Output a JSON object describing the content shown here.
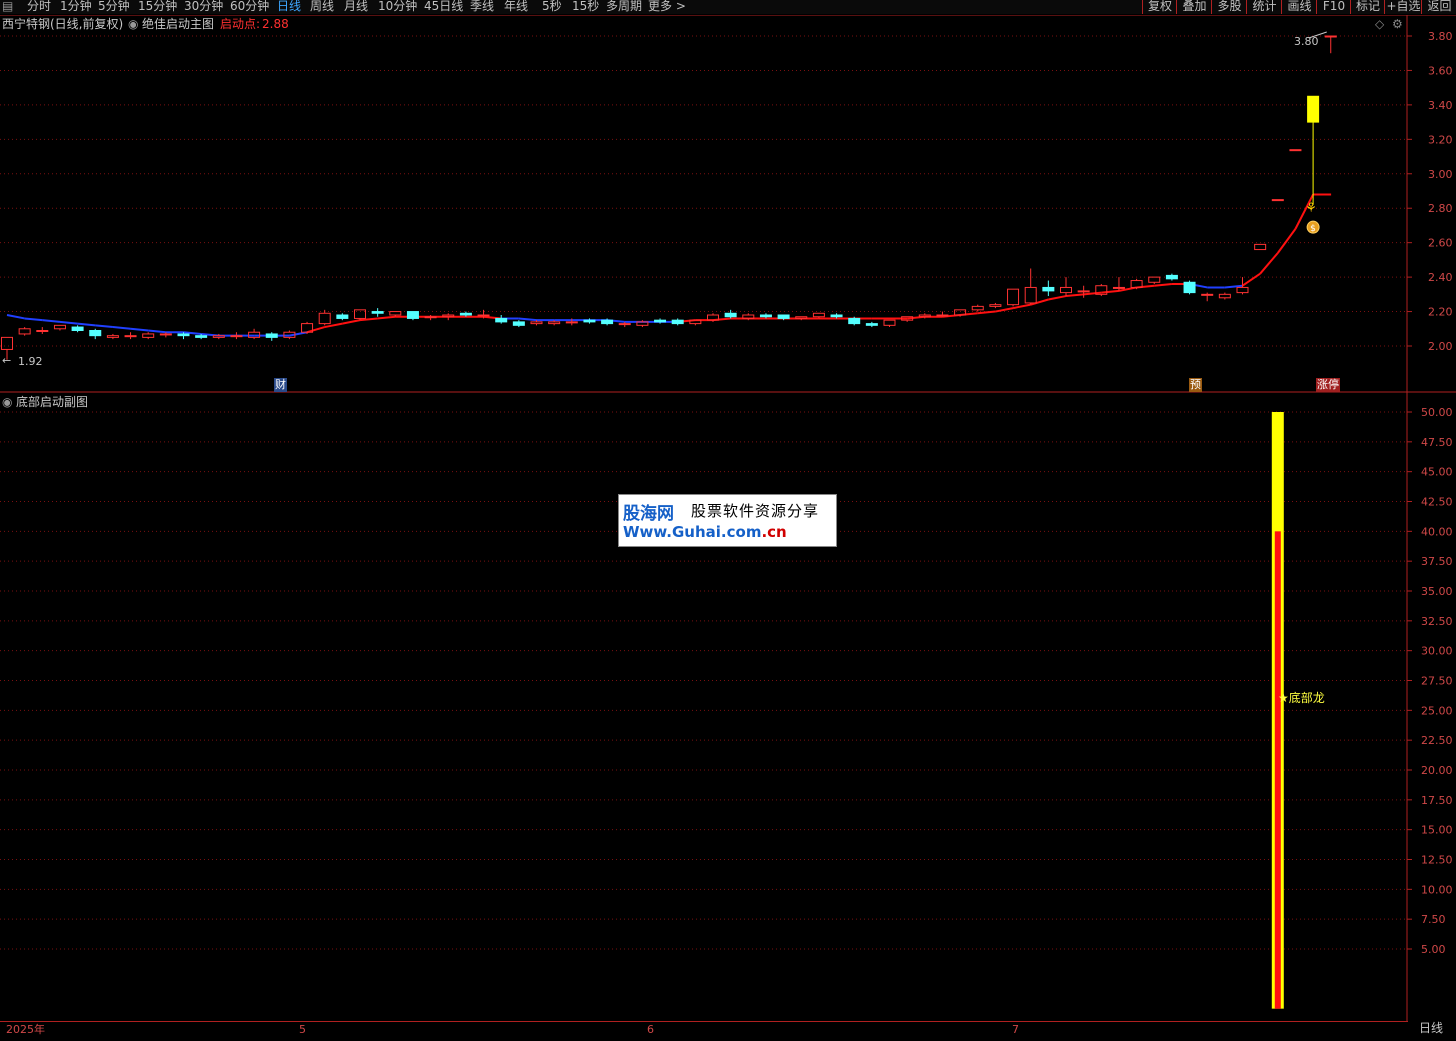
{
  "toolbar": {
    "periods": [
      "分时",
      "1分钟",
      "5分钟",
      "15分钟",
      "30分钟",
      "60分钟",
      "日线",
      "周线",
      "月线",
      "10分钟",
      "45日线",
      "季线",
      "年线",
      "5秒",
      "15秒",
      "多周期",
      "更多 >"
    ],
    "active_period": "日线",
    "right_buttons": [
      "复权",
      "叠加",
      "多股",
      "统计",
      "画线",
      "F10",
      "标记",
      "+自选",
      "返回"
    ]
  },
  "main_chart": {
    "stock_title": "西宁特钢(日线,前复权)",
    "indicator_name": "绝佳启动主图",
    "signal_label": "启动点:",
    "signal_value": "2.88",
    "high_marker": "3.80",
    "low_marker": "1.92",
    "event_badges": [
      "财",
      "预",
      "涨停"
    ],
    "y_ticks": [
      "3.80",
      "3.60",
      "3.40",
      "3.20",
      "3.00",
      "2.80",
      "2.60",
      "2.40",
      "2.20",
      "2.00"
    ]
  },
  "sub_chart": {
    "indicator_name": "底部启动副图",
    "signal_text": "★底部龙",
    "y_ticks": [
      "50.00",
      "47.50",
      "45.00",
      "42.50",
      "40.00",
      "37.50",
      "35.00",
      "32.50",
      "30.00",
      "27.50",
      "25.00",
      "22.50",
      "20.00",
      "17.50",
      "15.00",
      "12.50",
      "10.00",
      "7.50",
      "5.00"
    ]
  },
  "watermark": {
    "brand": "股海网",
    "tagline": "股票软件资源分享",
    "url_prefix": "Www.Guhai.com",
    "url_suffix": ".cn"
  },
  "date_axis": {
    "labels": [
      "2025年",
      "5",
      "6",
      "7"
    ]
  },
  "period_indicator": "日线",
  "colors": {
    "up": "#ff3232",
    "down": "#54ffff",
    "ma_down": "#2040ff",
    "ma_up": "#ff1010",
    "grid": "#7a1010",
    "limit_up": "#ffff00",
    "axis_text": "#d04848"
  },
  "chart_data": {
    "type": "candlestick",
    "x_range": [
      "2025-04",
      "2025-07"
    ],
    "ylim": [
      1.9,
      3.86
    ],
    "candles": [
      {
        "o": 1.98,
        "h": 2.05,
        "l": 1.92,
        "c": 2.05
      },
      {
        "o": 2.07,
        "h": 2.11,
        "l": 2.06,
        "c": 2.1
      },
      {
        "o": 2.09,
        "h": 2.11,
        "l": 2.07,
        "c": 2.09
      },
      {
        "o": 2.1,
        "h": 2.12,
        "l": 2.09,
        "c": 2.12
      },
      {
        "o": 2.11,
        "h": 2.12,
        "l": 2.08,
        "c": 2.09
      },
      {
        "o": 2.09,
        "h": 2.1,
        "l": 2.04,
        "c": 2.06
      },
      {
        "o": 2.05,
        "h": 2.07,
        "l": 2.04,
        "c": 2.06
      },
      {
        "o": 2.06,
        "h": 2.08,
        "l": 2.04,
        "c": 2.06
      },
      {
        "o": 2.05,
        "h": 2.08,
        "l": 2.04,
        "c": 2.07
      },
      {
        "o": 2.07,
        "h": 2.08,
        "l": 2.05,
        "c": 2.07
      },
      {
        "o": 2.07,
        "h": 2.08,
        "l": 2.04,
        "c": 2.06
      },
      {
        "o": 2.06,
        "h": 2.07,
        "l": 2.04,
        "c": 2.05
      },
      {
        "o": 2.05,
        "h": 2.07,
        "l": 2.04,
        "c": 2.06
      },
      {
        "o": 2.06,
        "h": 2.08,
        "l": 2.04,
        "c": 2.06
      },
      {
        "o": 2.05,
        "h": 2.1,
        "l": 2.04,
        "c": 2.08
      },
      {
        "o": 2.07,
        "h": 2.08,
        "l": 2.03,
        "c": 2.05
      },
      {
        "o": 2.05,
        "h": 2.09,
        "l": 2.04,
        "c": 2.08
      },
      {
        "o": 2.08,
        "h": 2.14,
        "l": 2.07,
        "c": 2.13
      },
      {
        "o": 2.13,
        "h": 2.21,
        "l": 2.12,
        "c": 2.19
      },
      {
        "o": 2.18,
        "h": 2.19,
        "l": 2.15,
        "c": 2.16
      },
      {
        "o": 2.16,
        "h": 2.21,
        "l": 2.15,
        "c": 2.21
      },
      {
        "o": 2.2,
        "h": 2.22,
        "l": 2.17,
        "c": 2.19
      },
      {
        "o": 2.18,
        "h": 2.2,
        "l": 2.17,
        "c": 2.2
      },
      {
        "o": 2.2,
        "h": 2.2,
        "l": 2.15,
        "c": 2.16
      },
      {
        "o": 2.17,
        "h": 2.18,
        "l": 2.15,
        "c": 2.17
      },
      {
        "o": 2.17,
        "h": 2.19,
        "l": 2.15,
        "c": 2.18
      },
      {
        "o": 2.19,
        "h": 2.2,
        "l": 2.17,
        "c": 2.18
      },
      {
        "o": 2.18,
        "h": 2.21,
        "l": 2.16,
        "c": 2.18
      },
      {
        "o": 2.16,
        "h": 2.18,
        "l": 2.13,
        "c": 2.14
      },
      {
        "o": 2.14,
        "h": 2.15,
        "l": 2.11,
        "c": 2.12
      },
      {
        "o": 2.13,
        "h": 2.15,
        "l": 2.12,
        "c": 2.14
      },
      {
        "o": 2.13,
        "h": 2.15,
        "l": 2.12,
        "c": 2.14
      },
      {
        "o": 2.14,
        "h": 2.16,
        "l": 2.12,
        "c": 2.14
      },
      {
        "o": 2.15,
        "h": 2.16,
        "l": 2.13,
        "c": 2.14
      },
      {
        "o": 2.15,
        "h": 2.16,
        "l": 2.12,
        "c": 2.13
      },
      {
        "o": 2.13,
        "h": 2.14,
        "l": 2.11,
        "c": 2.13
      },
      {
        "o": 2.12,
        "h": 2.15,
        "l": 2.11,
        "c": 2.14
      },
      {
        "o": 2.15,
        "h": 2.16,
        "l": 2.13,
        "c": 2.14
      },
      {
        "o": 2.15,
        "h": 2.16,
        "l": 2.12,
        "c": 2.13
      },
      {
        "o": 2.13,
        "h": 2.15,
        "l": 2.12,
        "c": 2.15
      },
      {
        "o": 2.15,
        "h": 2.19,
        "l": 2.14,
        "c": 2.18
      },
      {
        "o": 2.19,
        "h": 2.21,
        "l": 2.16,
        "c": 2.17
      },
      {
        "o": 2.16,
        "h": 2.19,
        "l": 2.15,
        "c": 2.18
      },
      {
        "o": 2.18,
        "h": 2.19,
        "l": 2.16,
        "c": 2.17
      },
      {
        "o": 2.18,
        "h": 2.18,
        "l": 2.15,
        "c": 2.16
      },
      {
        "o": 2.16,
        "h": 2.17,
        "l": 2.15,
        "c": 2.17
      },
      {
        "o": 2.17,
        "h": 2.19,
        "l": 2.16,
        "c": 2.19
      },
      {
        "o": 2.18,
        "h": 2.19,
        "l": 2.16,
        "c": 2.17
      },
      {
        "o": 2.16,
        "h": 2.17,
        "l": 2.12,
        "c": 2.13
      },
      {
        "o": 2.13,
        "h": 2.14,
        "l": 2.11,
        "c": 2.12
      },
      {
        "o": 2.12,
        "h": 2.15,
        "l": 2.11,
        "c": 2.15
      },
      {
        "o": 2.15,
        "h": 2.17,
        "l": 2.14,
        "c": 2.17
      },
      {
        "o": 2.17,
        "h": 2.19,
        "l": 2.16,
        "c": 2.18
      },
      {
        "o": 2.18,
        "h": 2.2,
        "l": 2.17,
        "c": 2.18
      },
      {
        "o": 2.18,
        "h": 2.21,
        "l": 2.17,
        "c": 2.21
      },
      {
        "o": 2.21,
        "h": 2.24,
        "l": 2.2,
        "c": 2.23
      },
      {
        "o": 2.23,
        "h": 2.25,
        "l": 2.22,
        "c": 2.24
      },
      {
        "o": 2.24,
        "h": 2.33,
        "l": 2.23,
        "c": 2.33
      },
      {
        "o": 2.25,
        "h": 2.45,
        "l": 2.24,
        "c": 2.34
      },
      {
        "o": 2.34,
        "h": 2.38,
        "l": 2.29,
        "c": 2.32
      },
      {
        "o": 2.31,
        "h": 2.4,
        "l": 2.29,
        "c": 2.34
      },
      {
        "o": 2.32,
        "h": 2.35,
        "l": 2.28,
        "c": 2.32
      },
      {
        "o": 2.3,
        "h": 2.36,
        "l": 2.29,
        "c": 2.35
      },
      {
        "o": 2.34,
        "h": 2.4,
        "l": 2.32,
        "c": 2.34
      },
      {
        "o": 2.34,
        "h": 2.39,
        "l": 2.33,
        "c": 2.38
      },
      {
        "o": 2.37,
        "h": 2.4,
        "l": 2.36,
        "c": 2.4
      },
      {
        "o": 2.41,
        "h": 2.42,
        "l": 2.38,
        "c": 2.39
      },
      {
        "o": 2.37,
        "h": 2.38,
        "l": 2.3,
        "c": 2.31
      },
      {
        "o": 2.3,
        "h": 2.31,
        "l": 2.26,
        "c": 2.3
      },
      {
        "o": 2.28,
        "h": 2.31,
        "l": 2.27,
        "c": 2.3
      },
      {
        "o": 2.31,
        "h": 2.4,
        "l": 2.3,
        "c": 2.34
      },
      {
        "o": 2.56,
        "h": 2.59,
        "l": 2.56,
        "c": 2.59
      },
      {
        "o": 2.85,
        "h": 2.85,
        "l": 2.85,
        "c": 2.85
      },
      {
        "o": 3.14,
        "h": 3.14,
        "l": 3.14,
        "c": 3.14
      },
      {
        "o": 3.3,
        "h": 3.45,
        "l": 2.82,
        "c": 3.45
      },
      {
        "o": 3.8,
        "h": 3.8,
        "l": 3.7,
        "c": 3.8
      }
    ],
    "ma": [
      2.18,
      2.16,
      2.15,
      2.14,
      2.13,
      2.12,
      2.11,
      2.1,
      2.09,
      2.08,
      2.08,
      2.07,
      2.06,
      2.06,
      2.06,
      2.06,
      2.06,
      2.08,
      2.11,
      2.13,
      2.15,
      2.16,
      2.17,
      2.17,
      2.17,
      2.17,
      2.17,
      2.17,
      2.16,
      2.16,
      2.15,
      2.15,
      2.15,
      2.15,
      2.15,
      2.14,
      2.14,
      2.14,
      2.14,
      2.15,
      2.15,
      2.16,
      2.16,
      2.16,
      2.16,
      2.16,
      2.16,
      2.16,
      2.16,
      2.16,
      2.16,
      2.16,
      2.17,
      2.17,
      2.18,
      2.19,
      2.2,
      2.22,
      2.24,
      2.27,
      2.29,
      2.3,
      2.31,
      2.32,
      2.34,
      2.35,
      2.36,
      2.36,
      2.34,
      2.34,
      2.35,
      2.42,
      2.54,
      2.68,
      2.88
    ],
    "sub_bars": [
      {
        "index": 72,
        "total": 50,
        "red": 40
      }
    ],
    "sub_ylim": [
      0,
      52
    ]
  }
}
